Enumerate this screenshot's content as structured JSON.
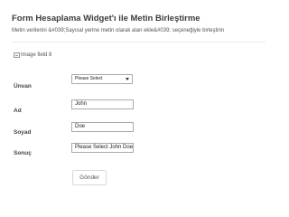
{
  "form": {
    "title": "Form Hesaplama Widget'ı ile Metin Birleştirme",
    "subtitle": "Metin verilerini &#039;Sayısal yerine metin olarak alan ekle&#039; seçeneğiyle birleştirin"
  },
  "image_field": {
    "alt_text": "Image field 8"
  },
  "fields": {
    "unvan": {
      "label": "Ünvan",
      "selected_value": "Please Select"
    },
    "ad": {
      "label": "Ad",
      "value": "John"
    },
    "soyad": {
      "label": "Soyad",
      "value": "Doe"
    },
    "sonuc": {
      "label": "Sonuç",
      "value": "Please Select John Doe"
    }
  },
  "submit": {
    "label": "Gönder"
  }
}
